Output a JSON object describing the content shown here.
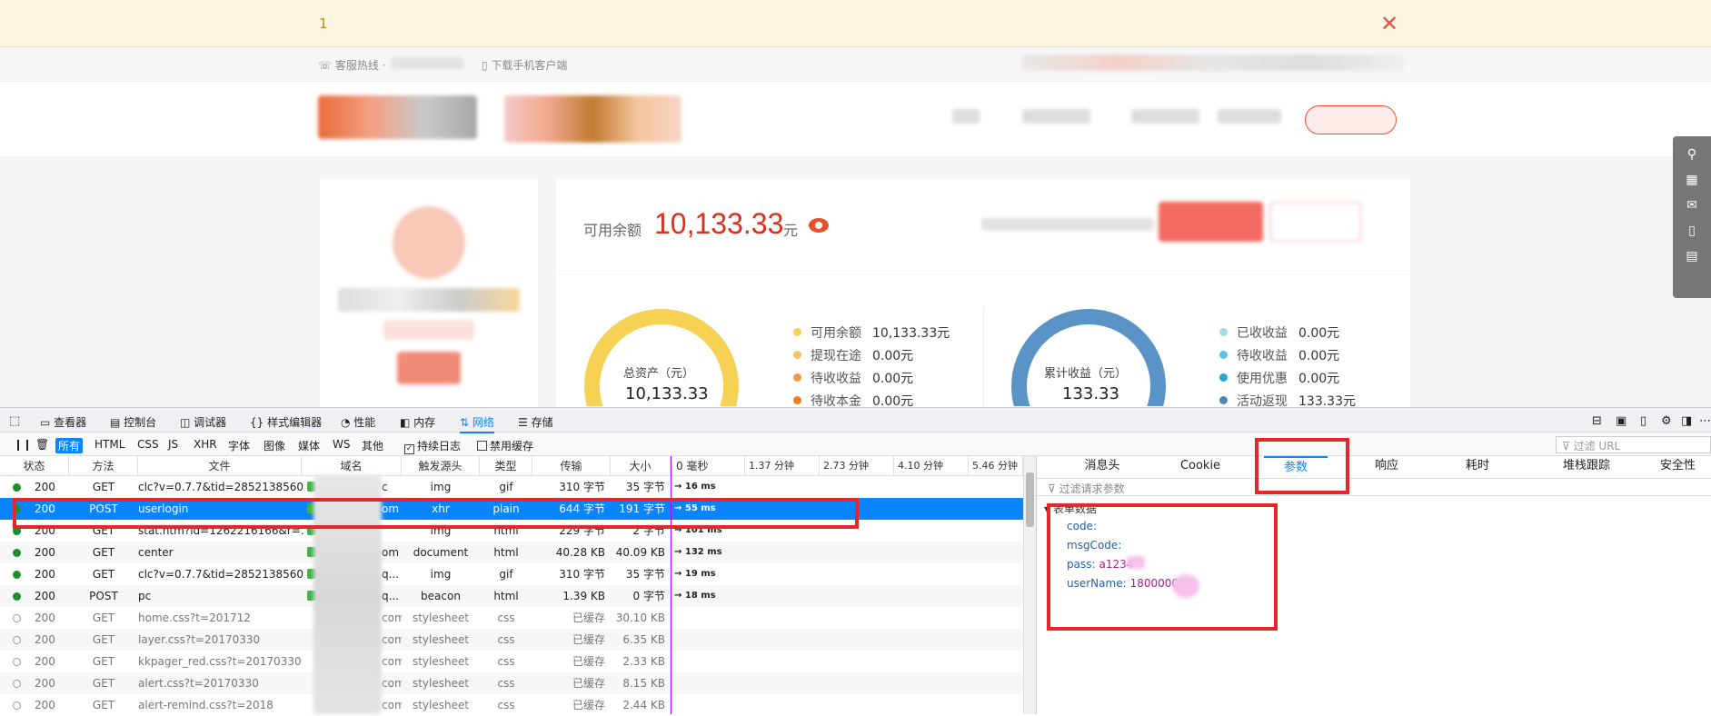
{
  "notice": {
    "text": "1",
    "close": "✕"
  },
  "header": {
    "hotline_label": "客服热线 ·",
    "download_label": "下载手机客户端"
  },
  "account": {
    "balance_label": "可用余额",
    "balance_value": "10,133.33",
    "balance_unit": "元",
    "total_assets_label": "总资产（元）",
    "total_assets_value": "10,133.33",
    "earnings_label": "累计收益（元）",
    "earnings_value": "133.33",
    "assets_legend": [
      {
        "label": "可用余额",
        "value": "10,133.33元",
        "color": "#f7d154"
      },
      {
        "label": "提现在途",
        "value": "0.00元",
        "color": "#f5c266"
      },
      {
        "label": "待收收益",
        "value": "0.00元",
        "color": "#f39a3c"
      },
      {
        "label": "待收本金",
        "value": "0.00元",
        "color": "#ef7e27"
      }
    ],
    "earnings_legend": [
      {
        "label": "已收收益",
        "value": "0.00元",
        "color": "#9fd9f4"
      },
      {
        "label": "待收收益",
        "value": "0.00元",
        "color": "#5bc1e8"
      },
      {
        "label": "使用优惠",
        "value": "0.00元",
        "color": "#2ea2d4"
      },
      {
        "label": "活动返现",
        "value": "133.33元",
        "color": "#4d84b9"
      }
    ]
  },
  "devtools": {
    "tools": [
      "查看器",
      "控制台",
      "调试器",
      "样式编辑器",
      "性能",
      "内存",
      "网络",
      "存储"
    ],
    "filters": [
      "所有",
      "HTML",
      "CSS",
      "JS",
      "XHR",
      "字体",
      "图像",
      "媒体",
      "WS",
      "其他"
    ],
    "persist_log": "持续日志",
    "disable_cache": "禁用缓存",
    "filter_url_placeholder": "过滤 URL",
    "columns": [
      "状态",
      "方法",
      "文件",
      "域名",
      "触发源头",
      "类型",
      "传输",
      "大小",
      "0 毫秒",
      "1.37 分钟",
      "2.73 分钟",
      "4.10 分钟",
      "5.46 分钟"
    ],
    "requests": [
      {
        "status": "200",
        "method": "GET",
        "file": "clc?v=0.7.7&tid=2852138560...",
        "domain": "c",
        "cause": "img",
        "type": "gif",
        "transfer": "310 字节",
        "size": "35 字节",
        "timing": "→ 16 ms",
        "cached": false
      },
      {
        "status": "200",
        "method": "POST",
        "file": "userlogin",
        "domain": "om",
        "cause": "xhr",
        "type": "plain",
        "transfer": "644 字节",
        "size": "191 字节",
        "timing": "→ 55 ms",
        "cached": false
      },
      {
        "status": "200",
        "method": "GET",
        "file": "stat.htm?id=1262216166&r=...",
        "domain": "",
        "cause": "img",
        "type": "html",
        "transfer": "229 字节",
        "size": "2 字节",
        "timing": "→ 101 ms",
        "cached": false
      },
      {
        "status": "200",
        "method": "GET",
        "file": "center",
        "domain": "om",
        "cause": "document",
        "type": "html",
        "transfer": "40.28 KB",
        "size": "40.09 KB",
        "timing": "→ 132 ms",
        "cached": false
      },
      {
        "status": "200",
        "method": "GET",
        "file": "clc?v=0.7.7&tid=2852138560...",
        "domain": "q...",
        "cause": "img",
        "type": "gif",
        "transfer": "310 字节",
        "size": "35 字节",
        "timing": "→ 19 ms",
        "cached": false
      },
      {
        "status": "200",
        "method": "POST",
        "file": "pc",
        "domain": "q...",
        "cause": "beacon",
        "type": "html",
        "transfer": "1.39 KB",
        "size": "0 字节",
        "timing": "→ 18 ms",
        "cached": false
      },
      {
        "status": "200",
        "method": "GET",
        "file": "home.css?t=201712",
        "domain": "com",
        "cause": "stylesheet",
        "type": "css",
        "transfer": "已缓存",
        "size": "30.10 KB",
        "timing": "",
        "cached": true
      },
      {
        "status": "200",
        "method": "GET",
        "file": "layer.css?t=20170330",
        "domain": "com",
        "cause": "stylesheet",
        "type": "css",
        "transfer": "已缓存",
        "size": "6.35 KB",
        "timing": "",
        "cached": true
      },
      {
        "status": "200",
        "method": "GET",
        "file": "kkpager_red.css?t=20170330",
        "domain": "com",
        "cause": "stylesheet",
        "type": "css",
        "transfer": "已缓存",
        "size": "2.33 KB",
        "timing": "",
        "cached": true
      },
      {
        "status": "200",
        "method": "GET",
        "file": "alert.css?t=20170330",
        "domain": "com",
        "cause": "stylesheet",
        "type": "css",
        "transfer": "已缓存",
        "size": "8.15 KB",
        "timing": "",
        "cached": true
      },
      {
        "status": "200",
        "method": "GET",
        "file": "alert-remind.css?t=2018",
        "domain": "com",
        "cause": "stylesheet",
        "type": "css",
        "transfer": "已缓存",
        "size": "2.44 KB",
        "timing": "",
        "cached": true
      }
    ],
    "detail_tabs": [
      "消息头",
      "Cookie",
      "参数",
      "响应",
      "耗时",
      "堆栈跟踪",
      "安全性"
    ],
    "active_detail_tab": "参数",
    "filter_params_placeholder": "过滤请求参数",
    "form_data_label": "表单数据",
    "params": [
      {
        "key": "code:",
        "value": ""
      },
      {
        "key": "msgCode:",
        "value": ""
      },
      {
        "key": "pass:",
        "value": "a1234"
      },
      {
        "key": "userName:",
        "value": "1800000("
      }
    ]
  }
}
